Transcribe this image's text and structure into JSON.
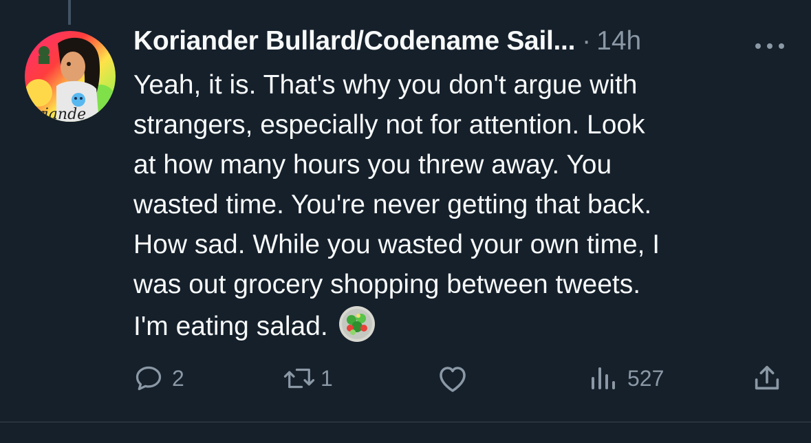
{
  "tweet": {
    "author_name": "Koriander Bullard/Codename Sail...",
    "separator": "·",
    "timestamp": "14h",
    "text_lines": [
      "Yeah, it is. That's why you don't argue with",
      "strangers, especially not for attention. Look",
      "at how many hours you threw away. You",
      "wasted time. You're never getting that back.",
      "How sad. While you wasted your own time, I",
      "was out grocery shopping between tweets.",
      "I'm eating salad."
    ],
    "emoji": "salad-emoji",
    "avatar_text": "oriande"
  },
  "actions": {
    "reply_count": "2",
    "retweet_count": "1",
    "like_count": "",
    "views_count": "527"
  },
  "icons": {
    "more": "more-dots-icon",
    "reply": "reply-bubble-icon",
    "retweet": "retweet-icon",
    "like": "heart-icon",
    "views": "bar-chart-icon",
    "share": "share-icon"
  },
  "colors": {
    "background": "#15202b",
    "text": "#f7f9f9",
    "secondary": "#8b98a5",
    "divider": "#38444d"
  }
}
